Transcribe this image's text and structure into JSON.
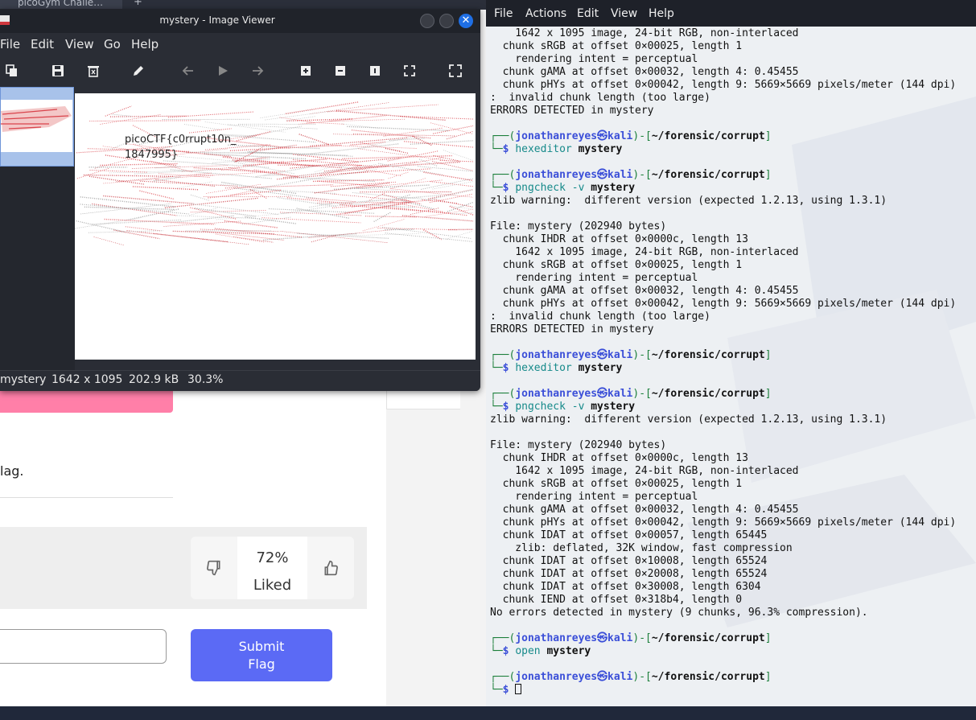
{
  "browser": {
    "tab_title": "picoGym Challe…",
    "new_tab": "+",
    "side_likes": "72%",
    "flag_text": "lag.",
    "rating": {
      "percent": "72%",
      "label": "Liked"
    },
    "submit_label": "Submit Flag",
    "colors": {
      "hint_button": "#ff7fa8",
      "submit_button": "#5b6af5"
    }
  },
  "viewer": {
    "title": "mystery - Image Viewer",
    "menu": [
      "File",
      "Edit",
      "View",
      "Go",
      "Help"
    ],
    "toolbar_icons": [
      "copy-icon",
      "save-icon",
      "delete-icon",
      "edit-icon",
      "back-icon",
      "play-icon",
      "forward-icon",
      "zoom-in-icon",
      "zoom-out-icon",
      "zoom-100-icon",
      "fit-icon",
      "fullscreen-icon"
    ],
    "image_text_line1": "picoCTF{c0rrupt10n_",
    "image_text_line2": "1847995}",
    "status": {
      "filename": "mystery",
      "dimensions": "1642 x 1095",
      "size": "202.9 kB",
      "zoom": "30.3%"
    }
  },
  "terminal": {
    "menu": [
      "File",
      "Actions",
      "Edit",
      "View",
      "Help"
    ],
    "lines": [
      "    1642 x 1095 image, 24-bit RGB, non-interlaced",
      "  chunk sRGB at offset 0×00025, length 1",
      "    rendering intent = perceptual",
      "  chunk gAMA at offset 0×00032, length 4: 0.45455",
      "  chunk pHYs at offset 0×00042, length 9: 5669×5669 pixels/meter (144 dpi)",
      ":  invalid chunk length (too large)",
      "ERRORS DETECTED in mystery",
      "",
      "P|hexeditor|mystery",
      "",
      "P|pngcheck -v|mystery",
      "zlib warning:  different version (expected 1.2.13, using 1.3.1)",
      "",
      "File: mystery (202940 bytes)",
      "  chunk IHDR at offset 0×0000c, length 13",
      "    1642 x 1095 image, 24-bit RGB, non-interlaced",
      "  chunk sRGB at offset 0×00025, length 1",
      "    rendering intent = perceptual",
      "  chunk gAMA at offset 0×00032, length 4: 0.45455",
      "  chunk pHYs at offset 0×00042, length 9: 5669×5669 pixels/meter (144 dpi)",
      ":  invalid chunk length (too large)",
      "ERRORS DETECTED in mystery",
      "",
      "P|hexeditor|mystery",
      "",
      "P|pngcheck -v|mystery",
      "zlib warning:  different version (expected 1.2.13, using 1.3.1)",
      "",
      "File: mystery (202940 bytes)",
      "  chunk IHDR at offset 0×0000c, length 13",
      "    1642 x 1095 image, 24-bit RGB, non-interlaced",
      "  chunk sRGB at offset 0×00025, length 1",
      "    rendering intent = perceptual",
      "  chunk gAMA at offset 0×00032, length 4: 0.45455",
      "  chunk pHYs at offset 0×00042, length 9: 5669×5669 pixels/meter (144 dpi)",
      "  chunk IDAT at offset 0×00057, length 65445",
      "    zlib: deflated, 32K window, fast compression",
      "  chunk IDAT at offset 0×10008, length 65524",
      "  chunk IDAT at offset 0×20008, length 65524",
      "  chunk IDAT at offset 0×30008, length 6304",
      "  chunk IEND at offset 0×318b4, length 0",
      "No errors detected in mystery (9 chunks, 96.3% compression).",
      "",
      "P|open|mystery",
      "",
      "P||"
    ],
    "prompt": {
      "user": "jonathanreyes",
      "symbol": "㉿",
      "host": "kali",
      "path": "~/forensic/corrupt"
    }
  }
}
